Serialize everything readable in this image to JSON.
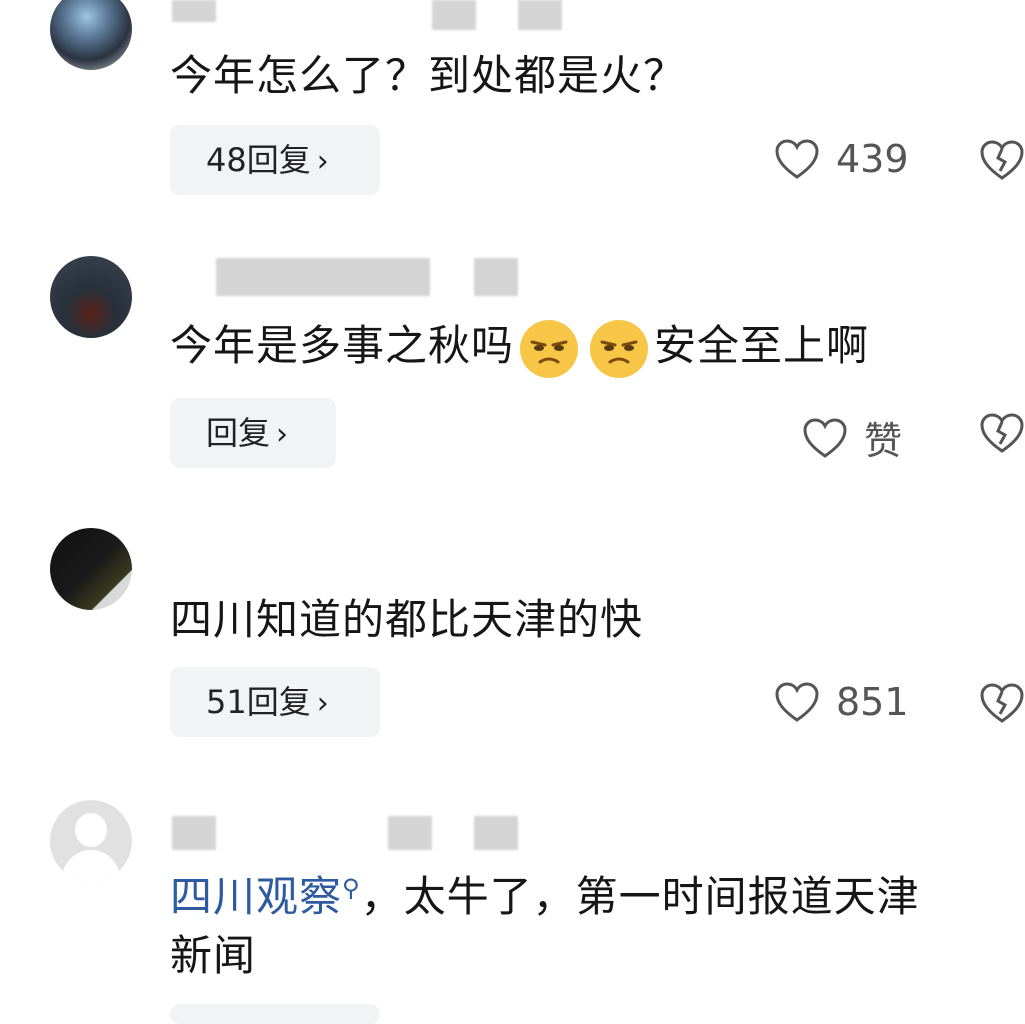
{
  "comments": [
    {
      "text": "今年怎么了？到处都是火？",
      "reply_label": "48回复",
      "reply_chevron": "›",
      "like_label": "439"
    },
    {
      "text_before": "今年是多事之秋吗",
      "emojis": [
        "pouting-face-emoji",
        "pouting-face-emoji"
      ],
      "text_after": "安全至上啊",
      "reply_label": "回复",
      "reply_chevron": "›",
      "like_label": "赞"
    },
    {
      "text": "四川知道的都比天津的快",
      "reply_label": "51回复",
      "reply_chevron": "›",
      "like_label": "851"
    },
    {
      "mention": "四川观察",
      "text_line1": "，太牛了，第一时间报道天津",
      "text_line2": "新闻"
    }
  ],
  "icons": {
    "like": "heart-outline-icon",
    "dislike": "broken-heart-icon",
    "mention": "search-icon"
  },
  "colors": {
    "mention": "#2d5aa0",
    "reply_bg": "#f2f3f5",
    "icon_stroke": "#555555"
  }
}
